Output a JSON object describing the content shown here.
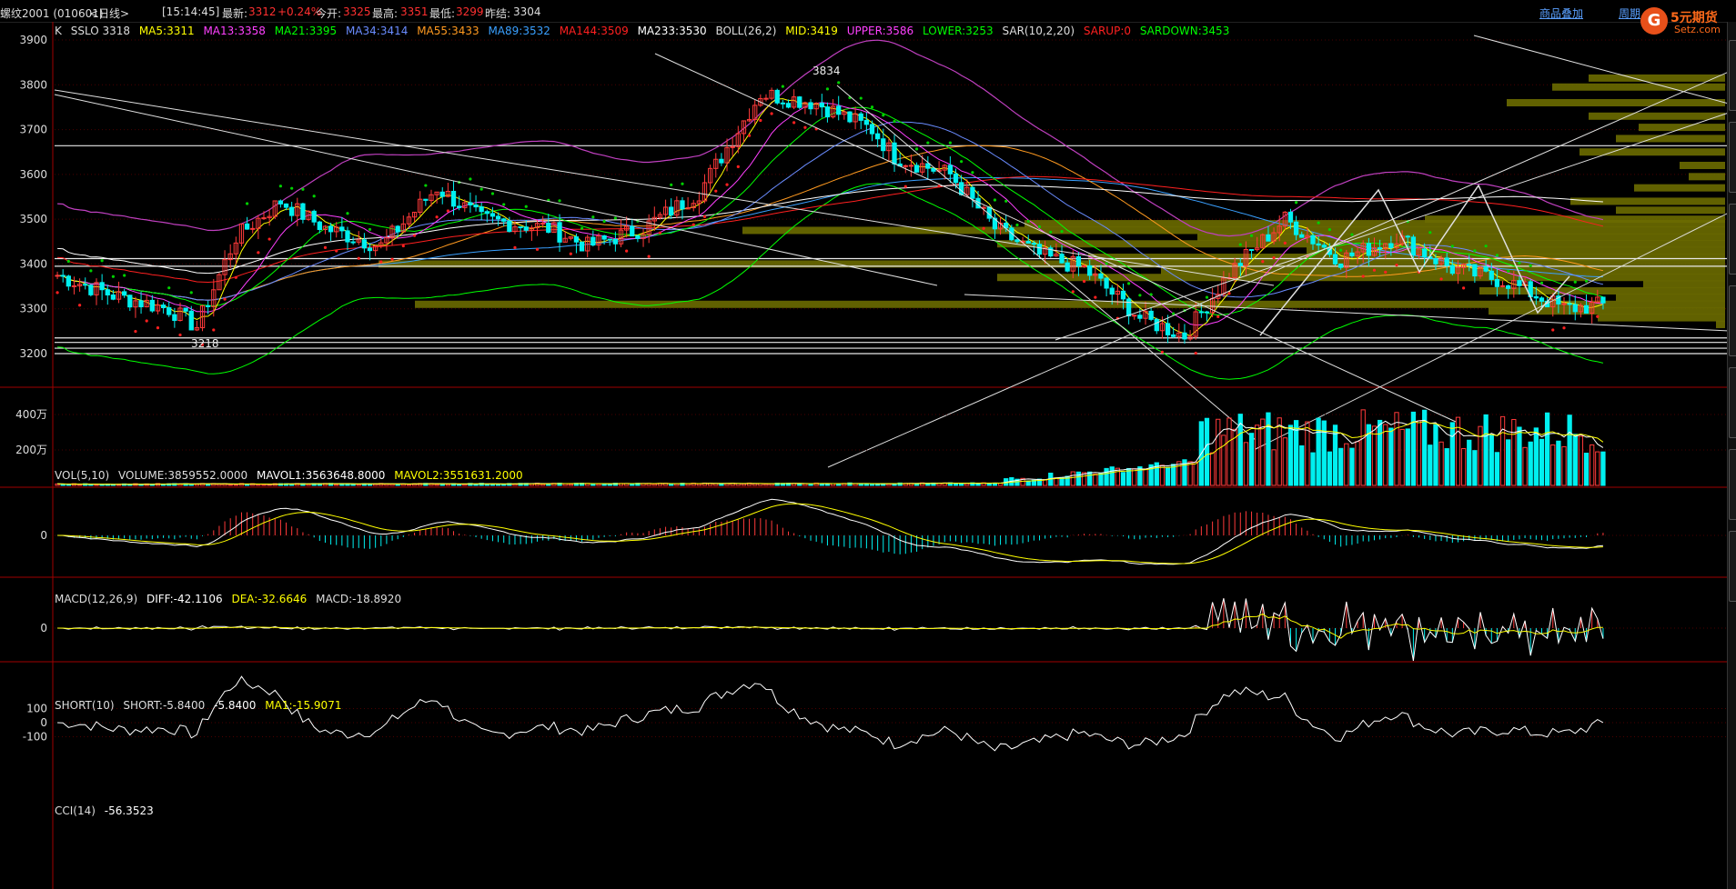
{
  "header": {
    "title": "螺纹2001 (010601)",
    "period_tag": "<日线>",
    "time": "[15:14:45]",
    "latest_label": "最新:",
    "latest_value": "3312",
    "change_pct": "+0.24%",
    "open_label": "今开:",
    "open_value": "3325",
    "high_label": "最高:",
    "high_value": "3351",
    "low_label": "最低:",
    "low_value": "3299",
    "prev_label": "昨结:",
    "prev_value": "3304",
    "link_overlay": "商品叠加",
    "link_period": "周期"
  },
  "logo": {
    "text": "5元期货",
    "sub": "Setz.com"
  },
  "price_indicator": {
    "k": "K",
    "sslo": "SSLO 3318",
    "ma5": "MA5:3311",
    "ma13": "MA13:3358",
    "ma21": "MA21:3395",
    "ma34": "MA34:3414",
    "ma55": "MA55:3433",
    "ma89": "MA89:3532",
    "ma144": "MA144:3509",
    "ma233": "MA233:3530",
    "boll": "BOLL(26,2)",
    "mid": "MID:3419",
    "upper": "UPPER:3586",
    "lower": "LOWER:3253",
    "sar": "SAR(10,2,20)",
    "sarup": "SARUP:0",
    "sardown": "SARDOWN:3453"
  },
  "price_axis": [
    "3900",
    "3800",
    "3700",
    "3600",
    "3500",
    "3400",
    "3300",
    "3200"
  ],
  "annotations": {
    "high": "3834",
    "low": "3218"
  },
  "vol_indicator": {
    "name": "VOL(5,10)",
    "volume": "VOLUME:3859552.0000",
    "mavol1": "MAVOL1:3563648.8000",
    "mavol2": "MAVOL2:3551631.2000"
  },
  "vol_axis": [
    "400万",
    "200万"
  ],
  "macd_indicator": {
    "name": "MACD(12,26,9)",
    "diff": "DIFF:-42.1106",
    "dea": "DEA:-32.6646",
    "macd": "MACD:-18.8920"
  },
  "macd_axis": [
    "0"
  ],
  "short_indicator": {
    "name": "SHORT(10)",
    "short": "SHORT:-5.8400",
    "val": "-5.8400",
    "ma1": "MA1:-15.9071"
  },
  "short_axis": [
    "0"
  ],
  "cci_indicator": {
    "name": "CCI(14)",
    "value": "-56.3523"
  },
  "cci_axis": [
    "100",
    "0",
    "-100"
  ],
  "colors": {
    "up": "#ff3a3a",
    "down": "#00f0f0",
    "ma5": "#ffff00",
    "ma13": "#ff40ff",
    "ma21": "#00ff00",
    "ma34": "#6a8cff",
    "ma55": "#ff9a20",
    "ma89": "#3aa0ff",
    "ma144": "#ff2020",
    "ma233": "#ffffff",
    "boll": "#c040c0",
    "sar_up": "#ff2020",
    "sar_down": "#00d000",
    "vp": "#6b6b00"
  }
}
